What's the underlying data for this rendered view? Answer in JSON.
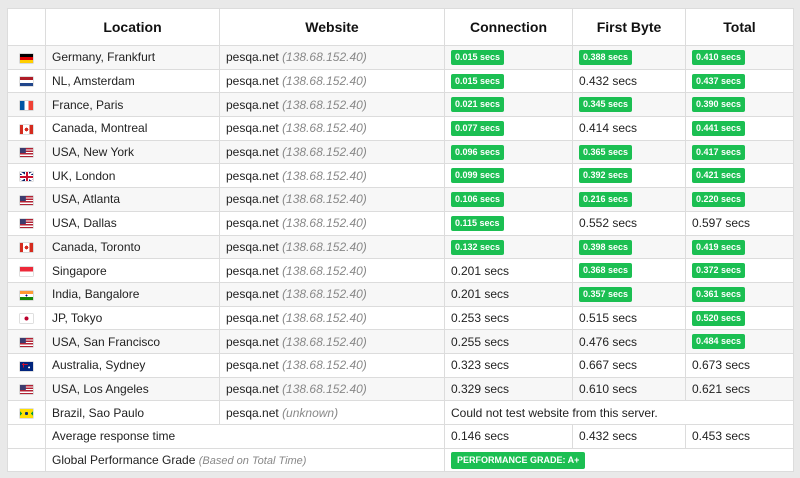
{
  "columns": [
    "Location",
    "Website",
    "Connection",
    "First Byte",
    "Total"
  ],
  "colors": {
    "badge_green": "#1bbf52",
    "text_gray": "#888888"
  },
  "rows": [
    {
      "flag": "de",
      "location": "Germany, Frankfurt",
      "site": "pesqa.net",
      "ip": "(138.68.152.40)",
      "connection": "0.015 secs",
      "conn_badge": true,
      "first_byte": "0.388 secs",
      "fb_badge": true,
      "total": "0.410 secs",
      "total_badge": true
    },
    {
      "flag": "nl",
      "location": "NL, Amsterdam",
      "site": "pesqa.net",
      "ip": "(138.68.152.40)",
      "connection": "0.015 secs",
      "conn_badge": true,
      "first_byte": "0.432 secs",
      "fb_badge": false,
      "total": "0.437 secs",
      "total_badge": true
    },
    {
      "flag": "fr",
      "location": "France, Paris",
      "site": "pesqa.net",
      "ip": "(138.68.152.40)",
      "connection": "0.021 secs",
      "conn_badge": true,
      "first_byte": "0.345 secs",
      "fb_badge": true,
      "total": "0.390 secs",
      "total_badge": true
    },
    {
      "flag": "ca",
      "location": "Canada, Montreal",
      "site": "pesqa.net",
      "ip": "(138.68.152.40)",
      "connection": "0.077 secs",
      "conn_badge": true,
      "first_byte": "0.414 secs",
      "fb_badge": false,
      "total": "0.441 secs",
      "total_badge": true
    },
    {
      "flag": "us",
      "location": "USA, New York",
      "site": "pesqa.net",
      "ip": "(138.68.152.40)",
      "connection": "0.096 secs",
      "conn_badge": true,
      "first_byte": "0.365 secs",
      "fb_badge": true,
      "total": "0.417 secs",
      "total_badge": true
    },
    {
      "flag": "uk",
      "location": "UK, London",
      "site": "pesqa.net",
      "ip": "(138.68.152.40)",
      "connection": "0.099 secs",
      "conn_badge": true,
      "first_byte": "0.392 secs",
      "fb_badge": true,
      "total": "0.421 secs",
      "total_badge": true
    },
    {
      "flag": "us",
      "location": "USA, Atlanta",
      "site": "pesqa.net",
      "ip": "(138.68.152.40)",
      "connection": "0.106 secs",
      "conn_badge": true,
      "first_byte": "0.216 secs",
      "fb_badge": true,
      "total": "0.220 secs",
      "total_badge": true
    },
    {
      "flag": "us",
      "location": "USA, Dallas",
      "site": "pesqa.net",
      "ip": "(138.68.152.40)",
      "connection": "0.115 secs",
      "conn_badge": true,
      "first_byte": "0.552 secs",
      "fb_badge": false,
      "total": "0.597 secs",
      "total_badge": false
    },
    {
      "flag": "ca",
      "location": "Canada, Toronto",
      "site": "pesqa.net",
      "ip": "(138.68.152.40)",
      "connection": "0.132 secs",
      "conn_badge": true,
      "first_byte": "0.398 secs",
      "fb_badge": true,
      "total": "0.419 secs",
      "total_badge": true
    },
    {
      "flag": "sg",
      "location": "Singapore",
      "site": "pesqa.net",
      "ip": "(138.68.152.40)",
      "connection": "0.201 secs",
      "conn_badge": false,
      "first_byte": "0.368 secs",
      "fb_badge": true,
      "total": "0.372 secs",
      "total_badge": true
    },
    {
      "flag": "in",
      "location": "India, Bangalore",
      "site": "pesqa.net",
      "ip": "(138.68.152.40)",
      "connection": "0.201 secs",
      "conn_badge": false,
      "first_byte": "0.357 secs",
      "fb_badge": true,
      "total": "0.361 secs",
      "total_badge": true
    },
    {
      "flag": "jp",
      "location": "JP, Tokyo",
      "site": "pesqa.net",
      "ip": "(138.68.152.40)",
      "connection": "0.253 secs",
      "conn_badge": false,
      "first_byte": "0.515 secs",
      "fb_badge": false,
      "total": "0.520 secs",
      "total_badge": true
    },
    {
      "flag": "us",
      "location": "USA, San Francisco",
      "site": "pesqa.net",
      "ip": "(138.68.152.40)",
      "connection": "0.255 secs",
      "conn_badge": false,
      "first_byte": "0.476 secs",
      "fb_badge": false,
      "total": "0.484 secs",
      "total_badge": true
    },
    {
      "flag": "au",
      "location": "Australia, Sydney",
      "site": "pesqa.net",
      "ip": "(138.68.152.40)",
      "connection": "0.323 secs",
      "conn_badge": false,
      "first_byte": "0.667 secs",
      "fb_badge": false,
      "total": "0.673 secs",
      "total_badge": false
    },
    {
      "flag": "us",
      "location": "USA, Los Angeles",
      "site": "pesqa.net",
      "ip": "(138.68.152.40)",
      "connection": "0.329 secs",
      "conn_badge": false,
      "first_byte": "0.610 secs",
      "fb_badge": false,
      "total": "0.621 secs",
      "total_badge": false
    },
    {
      "flag": "br",
      "location": "Brazil, Sao Paulo",
      "site": "pesqa.net",
      "ip": "(unknown)",
      "message": "Could not test website from this server."
    }
  ],
  "average": {
    "label": "Average response time",
    "connection": "0.146 secs",
    "first_byte": "0.432 secs",
    "total": "0.453 secs"
  },
  "grade": {
    "label": "Global Performance Grade",
    "note": "(Based on Total Time)",
    "badge": "PERFORMANCE GRADE: A+"
  }
}
